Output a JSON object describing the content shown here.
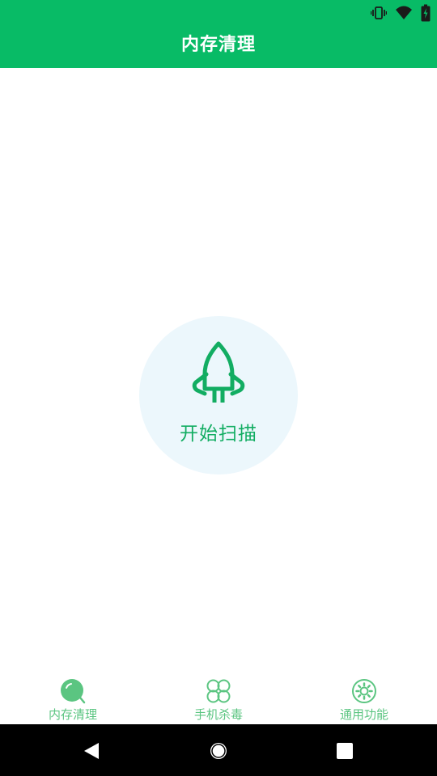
{
  "app": {
    "title": "内存清理"
  },
  "status_bar": {
    "icons": [
      "vibrate-icon",
      "wifi-icon",
      "battery-charging-icon"
    ]
  },
  "main": {
    "scan_button_label": "开始扫描",
    "scan_icon": "rocket-icon"
  },
  "bottom_nav": {
    "items": [
      {
        "label": "内存清理",
        "icon": "memory-clean-icon",
        "selected": true
      },
      {
        "label": "手机杀毒",
        "icon": "antivirus-icon",
        "selected": false
      },
      {
        "label": "通用功能",
        "icon": "settings-gear-icon",
        "selected": false
      }
    ]
  },
  "system_nav": {
    "buttons": [
      "back-icon",
      "home-icon",
      "recents-icon"
    ]
  },
  "colors": {
    "primary": "#08bb66",
    "accent_text": "#12ad62",
    "nav_active": "#5bc581",
    "circle_bg": "#ecf7fc",
    "system_bar": "#000000"
  }
}
